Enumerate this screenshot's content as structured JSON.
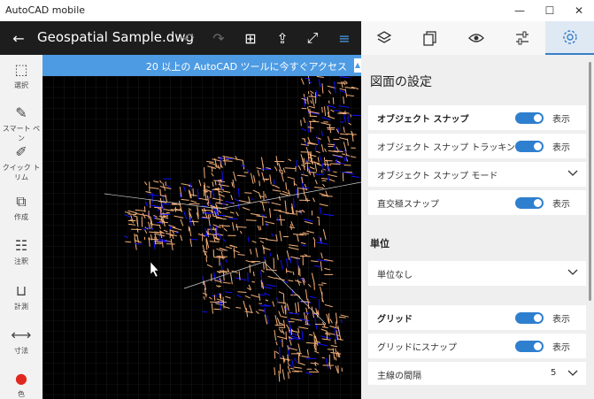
{
  "window": {
    "title": "AutoCAD mobile",
    "minimize": "—",
    "maximize": "☐",
    "close": "✕"
  },
  "toolbar": {
    "doc_name": "Geospatial Sample.dwg",
    "back": "←",
    "undo": "↶",
    "redo": "↷",
    "grid": "⊞",
    "share": "⇪",
    "fullscreen": "⤢",
    "menu": "≡"
  },
  "banner": {
    "text": "20 以上の AutoCAD ツールに今すぐアクセス",
    "icon": "▲"
  },
  "tools": [
    {
      "label": "選択",
      "icon": "select-icon",
      "glyph": "⬚"
    },
    {
      "label": "スマート ペン",
      "icon": "smart-pen-icon",
      "glyph": "✎"
    },
    {
      "label": "クイック トリム",
      "icon": "quick-trim-icon",
      "glyph": "✐"
    },
    {
      "label": "作成",
      "icon": "create-icon",
      "glyph": "⧉"
    },
    {
      "label": "注釈",
      "icon": "annotate-icon",
      "glyph": "☷"
    },
    {
      "label": "計測",
      "icon": "measure-icon",
      "glyph": "⊔"
    },
    {
      "label": "寸法",
      "icon": "dimension-icon",
      "glyph": "⟷"
    },
    {
      "label": "色",
      "icon": "color-icon",
      "glyph": "●"
    }
  ],
  "panel": {
    "title": "図面の設定",
    "snap_rows": [
      {
        "label": "オブジェクト スナップ",
        "bold": true,
        "type": "toggle",
        "state": "表示"
      },
      {
        "label": "オブジェクト スナップ トラッキング",
        "bold": false,
        "type": "toggle",
        "state": "表示"
      },
      {
        "label": "オブジェクト スナップ モード",
        "bold": false,
        "type": "dropdown"
      },
      {
        "label": "直交極スナップ",
        "bold": false,
        "type": "toggle",
        "state": "表示"
      }
    ],
    "units_heading": "単位",
    "units_value": "単位なし",
    "grid_rows": [
      {
        "label": "グリッド",
        "bold": true,
        "type": "toggle",
        "state": "表示"
      },
      {
        "label": "グリッドにスナップ",
        "bold": false,
        "type": "toggle",
        "state": "表示"
      },
      {
        "label": "主線の間隔",
        "bold": false,
        "type": "number",
        "value": "5"
      }
    ]
  },
  "colors": {
    "accent": "#2f7fcf",
    "banner": "#4d9be3",
    "map_roads": "#f5b07a",
    "map_water": "#1010ff"
  }
}
